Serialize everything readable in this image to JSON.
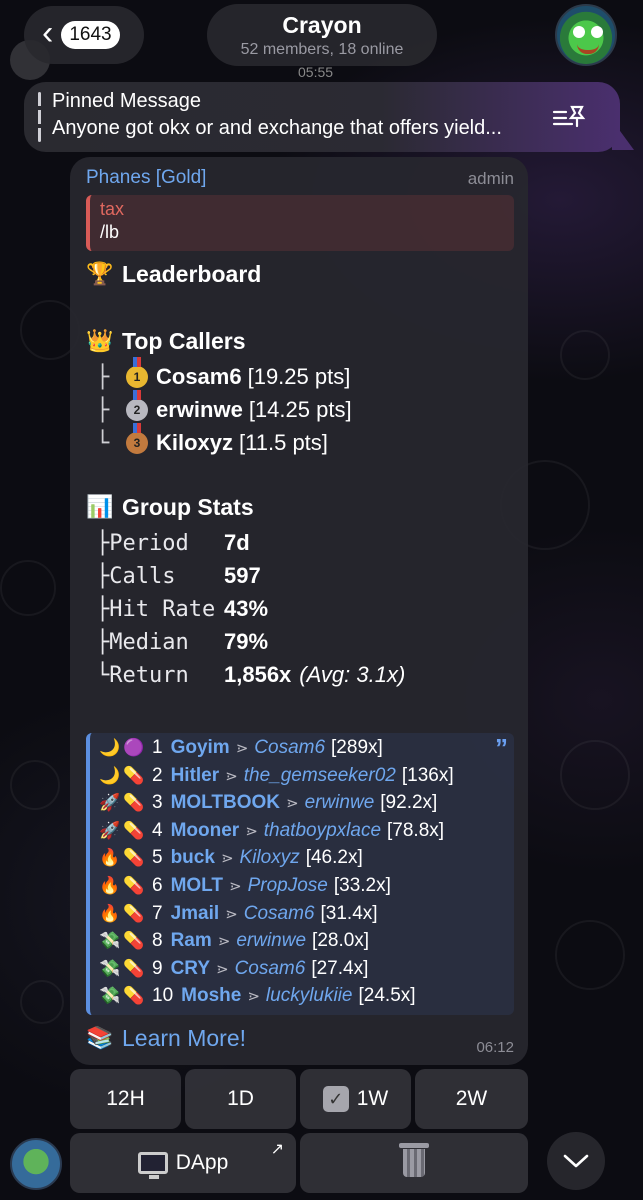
{
  "header": {
    "back_count": "1643",
    "title": "Crayon",
    "subtitle": "52 members, 18 online",
    "time": "05:55"
  },
  "pinned": {
    "title": "Pinned Message",
    "text": "Anyone got okx or and exchange that offers yield..."
  },
  "message": {
    "sender": "Phanes [Gold]",
    "badge": "admin",
    "reply": {
      "name": "tax",
      "text": "/lb"
    },
    "leaderboard_title": "Leaderboard",
    "top_callers_title": "Top Callers",
    "top_callers": [
      {
        "tree": "├",
        "medal": "1",
        "name": "Cosam6",
        "pts": "[19.25 pts]"
      },
      {
        "tree": "├",
        "medal": "2",
        "name": "erwinwe",
        "pts": "[14.25 pts]"
      },
      {
        "tree": "└",
        "medal": "3",
        "name": "Kiloxyz",
        "pts": "[11.5 pts]"
      }
    ],
    "group_stats_title": "Group Stats",
    "stats": [
      {
        "label": "├Period",
        "value": "7d",
        "extra": ""
      },
      {
        "label": "├Calls",
        "value": "597",
        "extra": ""
      },
      {
        "label": "├Hit Rate",
        "value": "43%",
        "extra": ""
      },
      {
        "label": "├Median",
        "value": "79%",
        "extra": ""
      },
      {
        "label": "└Return",
        "value": "1,856x",
        "extra": "(Avg: 3.1x)"
      }
    ],
    "leaderboard": [
      {
        "emo1": "🌙",
        "emo2": "🟣",
        "rank": "1",
        "token": "Goyim",
        "caller": "Cosam6",
        "mult": "[289x]"
      },
      {
        "emo1": "🌙",
        "emo2": "💊",
        "rank": "2",
        "token": "Hitler",
        "caller": "the_gemseeker02",
        "mult": "[136x]"
      },
      {
        "emo1": "🚀",
        "emo2": "💊",
        "rank": "3",
        "token": "MOLTBOOK",
        "caller": "erwinwe",
        "mult": "[92.2x]"
      },
      {
        "emo1": "🚀",
        "emo2": "💊",
        "rank": "4",
        "token": "Mooner",
        "caller": "thatboypxlace",
        "mult": "[78.8x]"
      },
      {
        "emo1": "🔥",
        "emo2": "💊",
        "rank": "5",
        "token": "buck",
        "caller": "Kiloxyz",
        "mult": "[46.2x]"
      },
      {
        "emo1": "🔥",
        "emo2": "💊",
        "rank": "6",
        "token": "MOLT",
        "caller": "PropJose",
        "mult": "[33.2x]"
      },
      {
        "emo1": "🔥",
        "emo2": "💊",
        "rank": "7",
        "token": "Jmail",
        "caller": "Cosam6",
        "mult": "[31.4x]"
      },
      {
        "emo1": "💸",
        "emo2": "💊",
        "rank": "8",
        "token": "Ram",
        "caller": "erwinwe",
        "mult": "[28.0x]"
      },
      {
        "emo1": "💸",
        "emo2": "💊",
        "rank": "9",
        "token": "CRY",
        "caller": "Cosam6",
        "mult": "[27.4x]"
      },
      {
        "emo1": "💸",
        "emo2": "💊",
        "rank": "10",
        "token": "Moshe",
        "caller": "luckylukiie",
        "mult": "[24.5x]"
      }
    ],
    "arrow": "⋗",
    "learn_more": "Learn More!",
    "time": "06:12"
  },
  "keyboard": {
    "row1": [
      "12H",
      "1D",
      "1W",
      "2W"
    ],
    "selected": "1W",
    "dapp_label": "DApp"
  },
  "icons": {
    "leaderboard": "trophy-icon",
    "top_callers": "crown-icon",
    "group_stats": "bar-chart-icon",
    "learn_more": "books-icon",
    "pin": "pin-list-icon",
    "scroll_down": "chevron-down-icon"
  },
  "colors": {
    "link": "#6fa7ee",
    "reply_accent": "#d85b57",
    "quote_accent": "#5c8fe0",
    "pinned_accent": "#4a2f6e"
  }
}
